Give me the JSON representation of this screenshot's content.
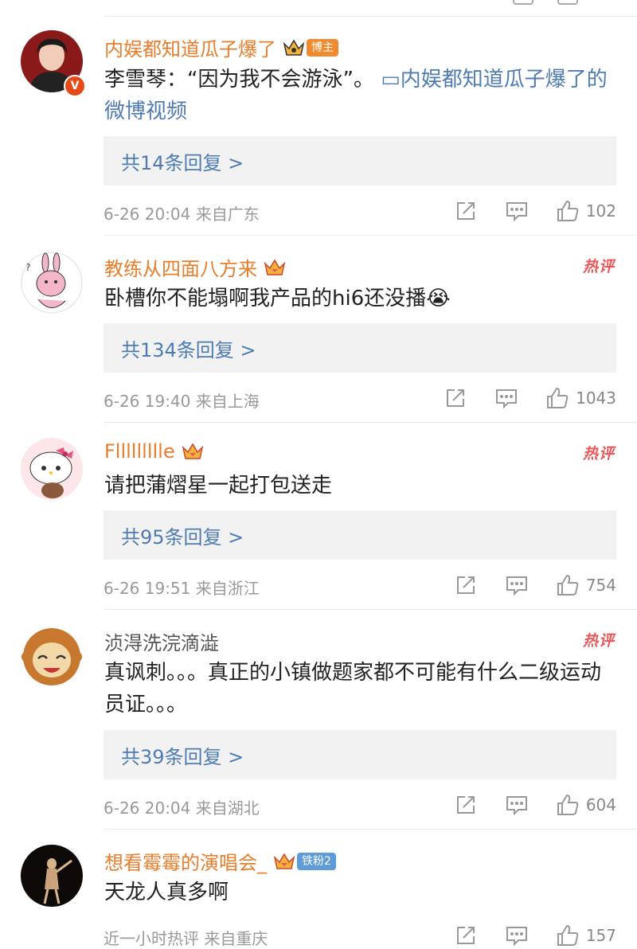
{
  "comments": [
    {
      "user": "内娱都知道瓜子爆了",
      "tag": "博主",
      "text": "李雪琴：“因为我不会游泳”。",
      "video_link": "内娱都知道瓜子爆了的微博视频",
      "replies_label": "共14条回复 >",
      "time": "6-26 20:04",
      "location": "来自广东",
      "likes": "102",
      "verified": "V"
    },
    {
      "user": "教练从四面八方来",
      "hot": "热评",
      "text": "卧槽你不能塌啊我产品的hi6还没播😭",
      "replies_label": "共134条回复 >",
      "time": "6-26 19:40",
      "location": "来自上海",
      "likes": "1043"
    },
    {
      "user": "Fllllllllle",
      "hot": "热评",
      "text": "请把蒲熠星一起打包送走",
      "replies_label": "共95条回复 >",
      "time": "6-26 19:51",
      "location": "来自浙江",
      "likes": "754"
    },
    {
      "user": "浈淂洗浣滴澁",
      "hot": "热评",
      "text": "真讽刺。。。真正的小镇做题家都不可能有什么二级运动员证。。。",
      "replies_label": "共39条回复 >",
      "time": "6-26 20:04",
      "location": "来自湖北",
      "likes": "604"
    },
    {
      "user": "想看霉霉的演唱会_",
      "tag": "铁粉2",
      "text": "天龙人真多啊",
      "time": "近一小时热评",
      "location": "来自重庆",
      "likes": "157"
    }
  ],
  "icons": {
    "share": "share-icon",
    "comment": "comment-icon",
    "like": "like-icon",
    "crown": "crown-icon",
    "video": "video-icon"
  },
  "colors": {
    "username": "#e87d2b",
    "link": "#4f7bb3",
    "hot": "#e85a5a",
    "reply_bg": "#f2f2f2",
    "meta": "#999999"
  }
}
